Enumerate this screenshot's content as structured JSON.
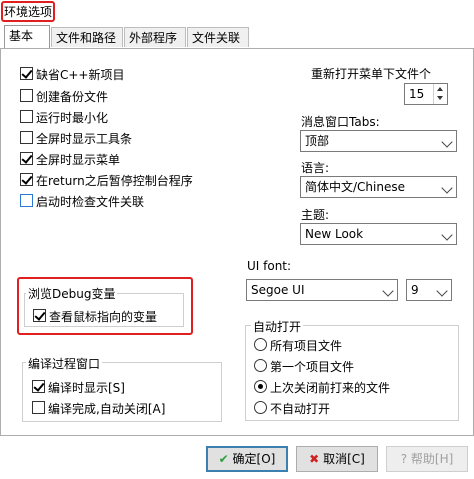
{
  "window": {
    "title": "环境选项"
  },
  "tabs": [
    {
      "label": "基本"
    },
    {
      "label": "文件和路径"
    },
    {
      "label": "外部程序"
    },
    {
      "label": "文件关联"
    }
  ],
  "general": {
    "checkboxes": [
      {
        "label": "缺省C++新项目",
        "checked": true
      },
      {
        "label": "创建备份文件",
        "checked": false
      },
      {
        "label": "运行时最小化",
        "checked": false
      },
      {
        "label": "全屏时显示工具条",
        "checked": false
      },
      {
        "label": "全屏时显示菜单",
        "checked": true
      },
      {
        "label": "在return之后暂停控制台程序",
        "checked": true
      },
      {
        "label": "启动时检查文件关联",
        "checked": false
      }
    ]
  },
  "reopen": {
    "label": "重新打开菜单下文件个",
    "value": "15"
  },
  "message_tabs": {
    "label": "消息窗口Tabs:",
    "value": "顶部"
  },
  "language": {
    "label": "语言:",
    "value": "简体中文/Chinese"
  },
  "theme": {
    "label": "主题:",
    "value": "New Look"
  },
  "ui_font": {
    "label": "UI font:",
    "font": "Segoe UI",
    "size": "9"
  },
  "debug_group": {
    "title": "浏览Debug变量",
    "checkbox": {
      "label": "查看鼠标指向的变量",
      "checked": true
    }
  },
  "compile_group": {
    "title": "编译过程窗口",
    "checkboxes": [
      {
        "label": "编译时显示[S]",
        "checked": true
      },
      {
        "label": "编译完成,自动关闭[A]",
        "checked": false
      }
    ]
  },
  "autoopen_group": {
    "title": "自动打开",
    "options": [
      {
        "label": "所有项目文件",
        "checked": false
      },
      {
        "label": "第一个项目文件",
        "checked": false
      },
      {
        "label": "上次关闭前打来的文件",
        "checked": true
      },
      {
        "label": "不自动打开",
        "checked": false
      }
    ]
  },
  "buttons": {
    "ok": "确定[O]",
    "cancel": "取消[C]",
    "help": "帮助[H]"
  },
  "colors": {
    "highlight_red": "#e02020",
    "ok_check": "#2e9e3e",
    "cancel_x": "#d02020",
    "default_border": "#3c7fb1"
  }
}
